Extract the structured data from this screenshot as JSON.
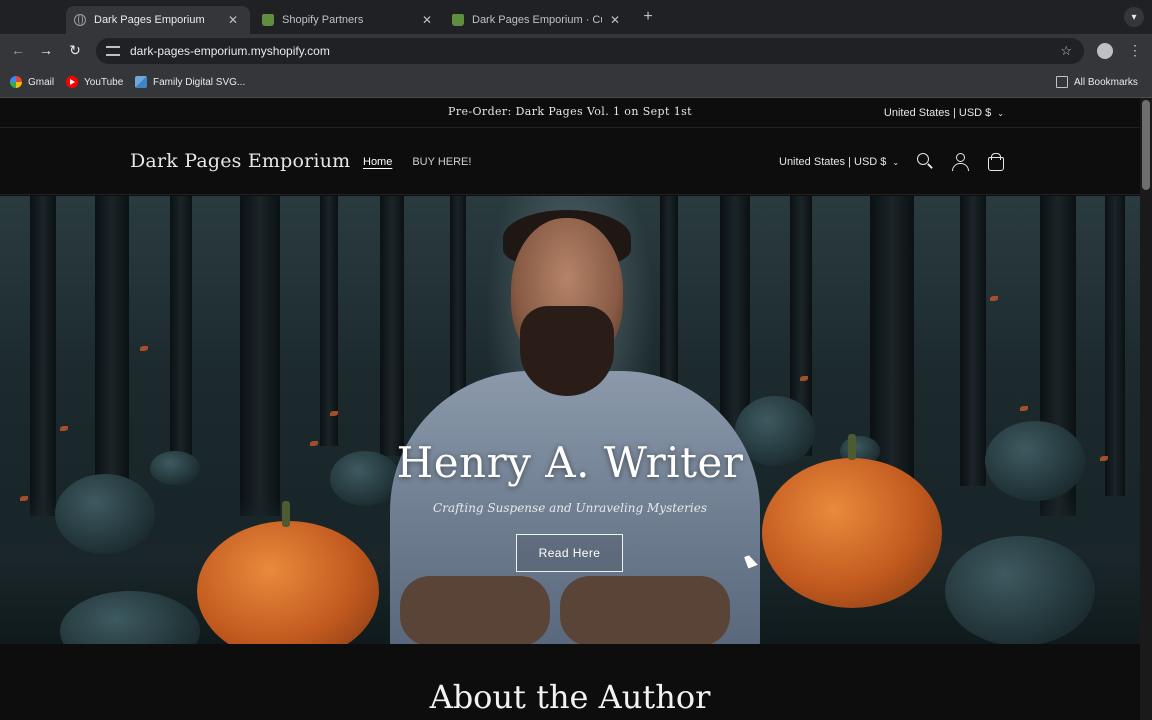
{
  "browser": {
    "tabs": [
      {
        "title": "Dark Pages Emporium",
        "icon": "globe-icon",
        "active": true
      },
      {
        "title": "Shopify Partners",
        "icon": "shopify-icon",
        "active": false
      },
      {
        "title": "Dark Pages Emporium · Custo",
        "icon": "shopify-icon",
        "active": false
      }
    ],
    "url": "dark-pages-emporium.myshopify.com",
    "bookmarks": [
      {
        "label": "Gmail",
        "icon": "google-icon"
      },
      {
        "label": "YouTube",
        "icon": "youtube-icon"
      },
      {
        "label": "Family Digital SVG...",
        "icon": "family-digital-icon"
      }
    ],
    "all_bookmarks": "All Bookmarks"
  },
  "store": {
    "announcement": "Pre-Order: Dark Pages Vol. 1 on Sept 1st",
    "locale_top": "United States | USD $",
    "logo": "Dark Pages Emporium",
    "nav": [
      {
        "label": "Home",
        "active": true
      },
      {
        "label": "BUY HERE!",
        "active": false
      }
    ],
    "locale_header": "United States | USD $",
    "hero": {
      "title": "Henry A. Writer",
      "subtitle": "Crafting Suspense and Unraveling Mysteries",
      "button": "Read Here"
    },
    "about_heading": "About the Author"
  },
  "colors": {
    "page_bg": "#0d0d0d",
    "chrome_bg": "#202124",
    "toolbar_bg": "#35363a",
    "pumpkin_orange": "#c25a1f"
  }
}
